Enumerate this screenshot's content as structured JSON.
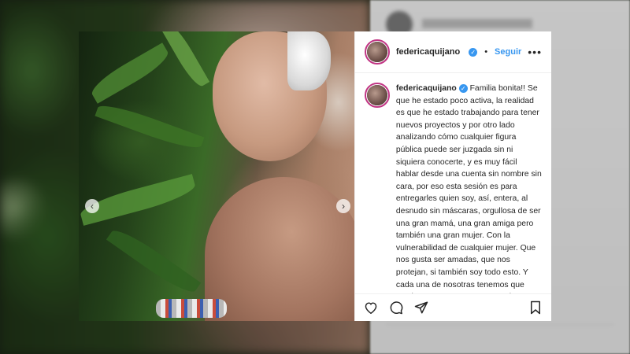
{
  "post": {
    "username": "federicaquijano",
    "follow_label": "Seguir",
    "separator": "•",
    "more_label": "•••",
    "verified_mark": "✓",
    "caption_username": "federicaquijano",
    "caption": "Familia bonita!! Se que he estado poco activa, la realidad es que he estado trabajando para tener nuevos proyectos y por otro lado analizando cómo cualquier figura pública puede ser juzgada sin ni siquiera conocerte, y es muy fácil hablar desde una cuenta sin nombre sin cara, por eso esta sesión es para entregarles quien soy, así, entera, al desnudo sin máscaras, orgullosa de ser una gran mamá, una gran amiga pero también una gran mujer. Con la vulnerabilidad de cualquier mujer. Que nos gusta ser amadas, que nos protejan, si también soy todo esto. Y cada una de nosotras tenemos que sentirnos a gusto y en paz con lo que somos, así...... Llegando a un punto de sensualidad",
    "carousel_prev": "‹",
    "carousel_next": "›"
  },
  "icons": {
    "like": "heart-icon",
    "comment": "comment-icon",
    "share": "share-icon",
    "save": "bookmark-icon"
  },
  "colors": {
    "accent_blue": "#3897f0",
    "text": "#262626",
    "avatar_ring": "#c13584"
  }
}
